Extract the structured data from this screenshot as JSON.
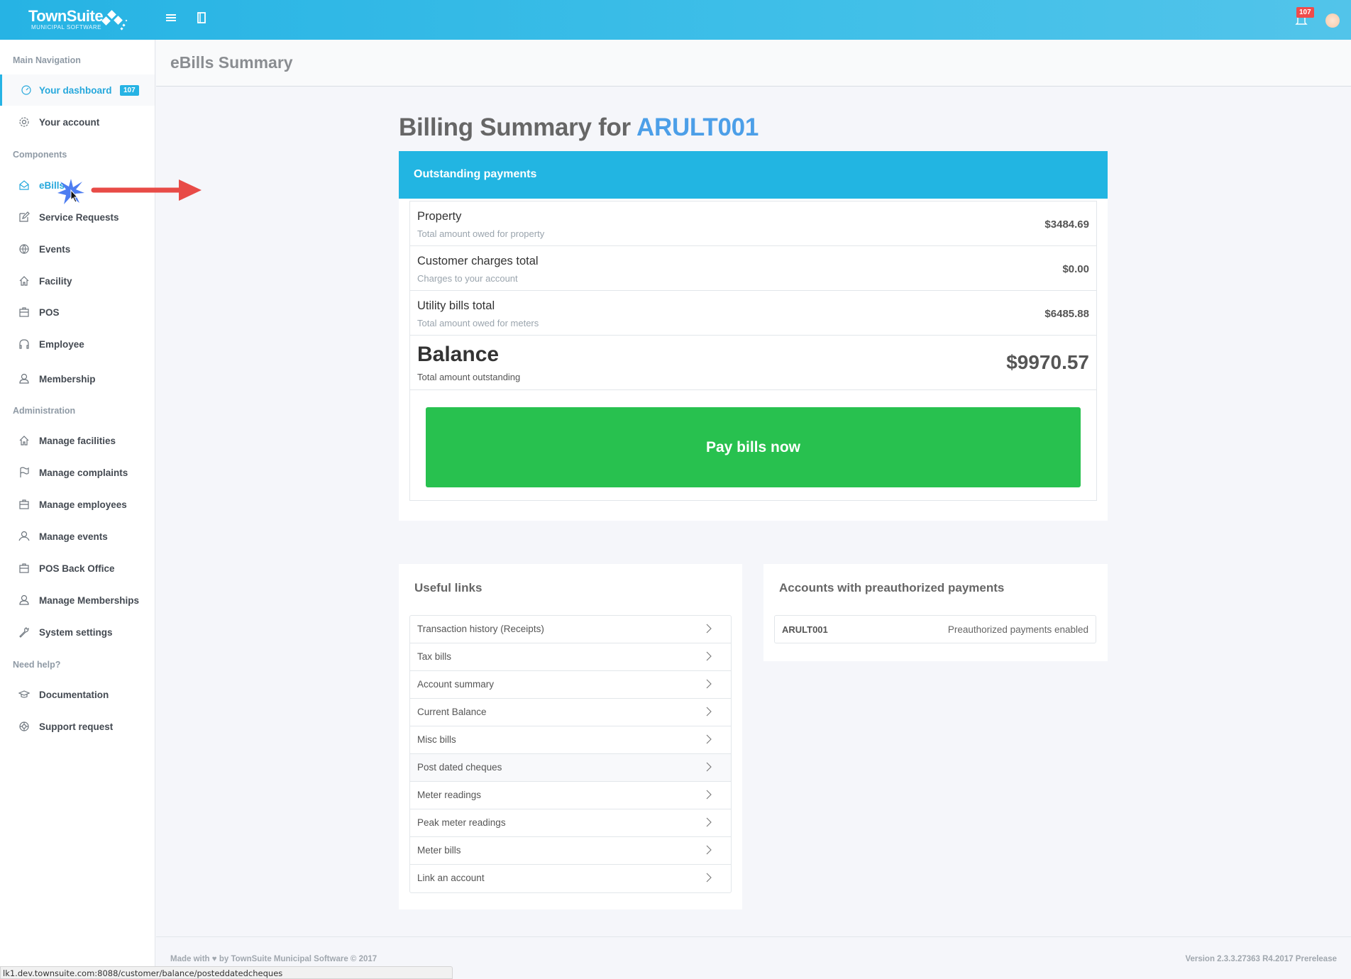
{
  "app": {
    "brand": "TownSuite",
    "brand_sub": "MUNICIPAL SOFTWARE",
    "notification_count": "107",
    "accent_color": "#26b3e4"
  },
  "sidebar": {
    "sections": [
      {
        "title": "Main Navigation",
        "items": [
          {
            "label": "Your dashboard",
            "icon": "dashboard-icon",
            "badge": "107",
            "active": true
          },
          {
            "label": "Your account",
            "icon": "gear-icon"
          }
        ]
      },
      {
        "title": "Components",
        "items": [
          {
            "label": "eBills",
            "icon": "mail-open-icon",
            "highlighted": true
          },
          {
            "label": "Service Requests",
            "icon": "edit-icon"
          },
          {
            "label": "Events",
            "icon": "basketball-icon"
          },
          {
            "label": "Facility",
            "icon": "home-icon"
          },
          {
            "label": "POS",
            "icon": "briefcase-icon"
          },
          {
            "label": "Employee",
            "icon": "headphones-icon"
          },
          {
            "label": "Membership",
            "icon": "user-icon"
          }
        ]
      },
      {
        "title": "Administration",
        "items": [
          {
            "label": "Manage facilities",
            "icon": "home-icon"
          },
          {
            "label": "Manage complaints",
            "icon": "flag-icon"
          },
          {
            "label": "Manage employees",
            "icon": "briefcase-icon"
          },
          {
            "label": "Manage events",
            "icon": "users-icon"
          },
          {
            "label": "POS Back Office",
            "icon": "briefcase-icon"
          },
          {
            "label": "Manage Memberships",
            "icon": "user-add-icon"
          },
          {
            "label": "System settings",
            "icon": "wrench-icon"
          }
        ]
      },
      {
        "title": "Need help?",
        "items": [
          {
            "label": "Documentation",
            "icon": "graduation-cap-icon"
          },
          {
            "label": "Support request",
            "icon": "lifebuoy-icon"
          }
        ]
      }
    ]
  },
  "page": {
    "title": "eBills Summary",
    "heading_prefix": "Billing Summary for",
    "account": "ARULT001"
  },
  "billing": {
    "header": "Outstanding payments",
    "rows": [
      {
        "name": "Property",
        "desc": "Total amount owed for property",
        "amount": "$3484.69"
      },
      {
        "name": "Customer charges total",
        "desc": "Charges to your account",
        "amount": "$0.00"
      },
      {
        "name": "Utility bills total",
        "desc": "Total amount owed for meters",
        "amount": "$6485.88"
      }
    ],
    "balance": {
      "name": "Balance",
      "desc": "Total amount outstanding",
      "amount": "$9970.57"
    },
    "pay_button": "Pay bills now",
    "pay_color": "#28c14f"
  },
  "useful_links": {
    "title": "Useful links",
    "items": [
      "Transaction history (Receipts)",
      "Tax bills",
      "Account summary",
      "Current Balance",
      "Misc bills",
      "Post dated cheques",
      "Meter readings",
      "Peak meter readings",
      "Meter bills",
      "Link an account"
    ],
    "hovered": "Post dated cheques"
  },
  "preauth": {
    "title": "Accounts with preauthorized payments",
    "rows": [
      {
        "account": "ARULT001",
        "status": "Preauthorized payments enabled"
      }
    ]
  },
  "footer": {
    "made_with_prefix": "Made with",
    "made_with_suffix": "by TownSuite Municipal Software © 2017",
    "version": "Version 2.3.3.27363 R4.2017 Prerelease"
  },
  "status_bar": {
    "url": "lk1.dev.townsuite.com:8088/customer/balance/posteddatedcheques"
  }
}
